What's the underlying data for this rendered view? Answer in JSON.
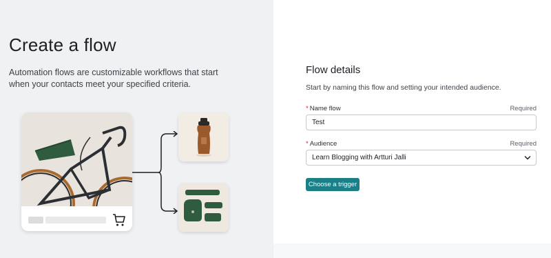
{
  "intro": {
    "title": "Create a flow",
    "description": "Automation flows are customizable workflows that start when your contacts meet your specified criteria."
  },
  "illustration": {
    "product_icons": [
      "bike-image",
      "cart-icon",
      "water-bottle-image",
      "bike-bags-image"
    ]
  },
  "form": {
    "title": "Flow details",
    "description": "Start by naming this flow and setting your intended audience.",
    "name_field": {
      "label": "Name flow",
      "required_note": "Required",
      "value": "Test"
    },
    "audience_field": {
      "label": "Audience",
      "required_note": "Required",
      "selected": "Learn Blogging with Artturi Jalli"
    },
    "trigger_button": "Choose a trigger"
  },
  "colors": {
    "accent": "#1a7f86",
    "required_star": "#d1242f",
    "left_panel_bg": "#f0f1f3"
  }
}
